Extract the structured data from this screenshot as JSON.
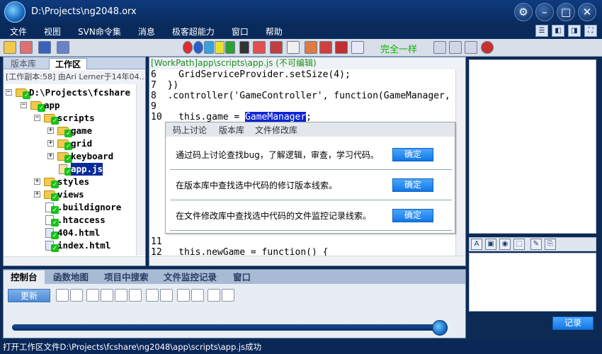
{
  "window": {
    "title": "D:\\Projects\\ng2048.orx",
    "controls": [
      "gear-icon",
      "minimize-icon",
      "maximize-icon",
      "close-icon"
    ]
  },
  "menu": [
    "文件",
    "视图",
    "SVN命令集",
    "消息",
    "极客超能力",
    "窗口",
    "帮助"
  ],
  "toolbar": {
    "sync_label": "完全一样"
  },
  "left_panel": {
    "tabs": [
      "版本库",
      "工作区"
    ],
    "active_tab": "工作区",
    "info": "[工作副本:58] 由Ari Lerner于14年04...",
    "tree": [
      {
        "label": "D:\\Projects\\fcshare",
        "depth": 0,
        "type": "folder",
        "expanded": true
      },
      {
        "label": "app",
        "depth": 1,
        "type": "folder",
        "expanded": true
      },
      {
        "label": "scripts",
        "depth": 2,
        "type": "folder",
        "expanded": true
      },
      {
        "label": "game",
        "depth": 3,
        "type": "folder",
        "expanded": false
      },
      {
        "label": "grid",
        "depth": 3,
        "type": "folder",
        "expanded": false
      },
      {
        "label": "keyboard",
        "depth": 3,
        "type": "folder",
        "expanded": false
      },
      {
        "label": "app.js",
        "depth": 3,
        "type": "js-file",
        "selected": true
      },
      {
        "label": "styles",
        "depth": 2,
        "type": "folder",
        "expanded": false
      },
      {
        "label": "views",
        "depth": 2,
        "type": "folder",
        "expanded": false
      },
      {
        "label": ".buildignore",
        "depth": 2,
        "type": "file"
      },
      {
        "label": ".htaccess",
        "depth": 2,
        "type": "file"
      },
      {
        "label": "404.html",
        "depth": 2,
        "type": "html-file"
      },
      {
        "label": "index.html",
        "depth": 2,
        "type": "html-file"
      }
    ]
  },
  "editor": {
    "path": "[WorkPath]app\\scripts\\app.js (不可编辑)",
    "lines": [
      {
        "num": "6",
        "text": "  GridServiceProvider.setSize(4);"
      },
      {
        "num": "7",
        "text": "})"
      },
      {
        "num": "8",
        "text": ".controller('GameController', function(GameManager,"
      },
      {
        "num": "9",
        "text": ""
      },
      {
        "num": "10",
        "text": "  this.game = ",
        "selected": "GameManager",
        "after": ";"
      },
      {
        "num": "11",
        "text": ""
      },
      {
        "num": "12",
        "text": "  this.newGame = function() {"
      }
    ]
  },
  "popup": {
    "tabs": [
      "码上讨论",
      "版本库",
      "文件修改库"
    ],
    "rows": [
      {
        "text": "通过码上讨论查找bug，了解逻辑，审查，学习代码。",
        "button": "确定"
      },
      {
        "text": "在版本库中查找选中代码的修订版本线索。",
        "button": "确定"
      },
      {
        "text": "在文件修改库中查找选中代码的文件监控记录线索。",
        "button": "确定"
      }
    ]
  },
  "bottom_panel": {
    "tabs": [
      "控制台",
      "函数地图",
      "项目中搜索",
      "文件监控记录",
      "窗口"
    ],
    "active_tab": "控制台",
    "refresh_label": "更新",
    "progress": 0.99
  },
  "right_panel": {
    "record_label": "记录"
  },
  "status": "打开工作区文件D:\\Projects\\fcshare\\ng2048\\app\\scripts\\app.js成功"
}
